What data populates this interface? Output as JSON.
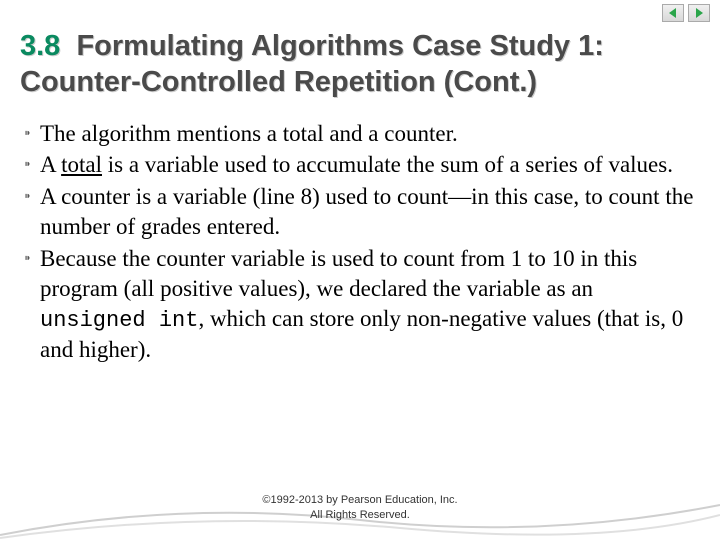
{
  "nav": {
    "prev_icon": "prev",
    "next_icon": "next"
  },
  "title": {
    "section_num": "3.8",
    "section_text": "Formulating Algorithms Case Study 1: Counter-Controlled Repetition (Cont.)"
  },
  "bullets": [
    {
      "text": "The algorithm mentions a total and a counter."
    },
    {
      "prefix": "A ",
      "underlined": "total",
      "suffix": " is a variable used to accumulate the sum of a series of values."
    },
    {
      "text": "A counter is a variable (line 8) used to count—in this case, to count the number of grades entered."
    },
    {
      "prefix": "Because the counter variable is used to count from 1 to 10 in this program (all positive values), we declared the variable as an ",
      "mono": "unsigned int",
      "suffix": ", which can store only non-negative values (that is, 0 and higher)."
    }
  ],
  "footer": {
    "line1": "©1992-2013 by Pearson Education, Inc.",
    "line2": "All Rights Reserved."
  }
}
